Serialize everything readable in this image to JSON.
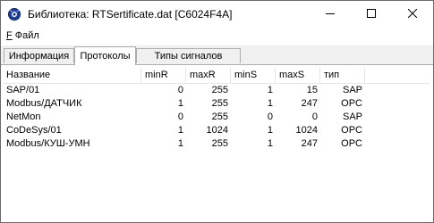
{
  "window": {
    "title": "Библиотека: RTSertificate.dat [C6024F4A]",
    "icon": "gear-sphere-icon"
  },
  "menu": {
    "items": [
      {
        "label": "Файл",
        "accelerator": "F"
      }
    ]
  },
  "tabs": [
    {
      "label": "Информация",
      "active": false
    },
    {
      "label": "Протоколы",
      "active": true
    },
    {
      "label": "Типы сигналов",
      "active": false
    }
  ],
  "table": {
    "columns": [
      "Название",
      "minR",
      "maxR",
      "minS",
      "maxS",
      "тип"
    ],
    "rows": [
      {
        "name": "SAP/01",
        "minR": "0",
        "maxR": "255",
        "minS": "1",
        "maxS": "15",
        "type": "SAP"
      },
      {
        "name": "Modbus/ДАТЧИК",
        "minR": "1",
        "maxR": "255",
        "minS": "1",
        "maxS": "247",
        "type": "OPC"
      },
      {
        "name": "NetMon",
        "minR": "0",
        "maxR": "255",
        "minS": "0",
        "maxS": "0",
        "type": "SAP"
      },
      {
        "name": "CoDeSys/01",
        "minR": "1",
        "maxR": "1024",
        "minS": "1",
        "maxS": "1024",
        "type": "OPC"
      },
      {
        "name": "Modbus/КУШ-УМН",
        "minR": "1",
        "maxR": "255",
        "minS": "1",
        "maxS": "247",
        "type": "OPC"
      }
    ]
  },
  "colors": {
    "border": "#adadad",
    "window_bg": "#f0f0f0",
    "panel_bg": "#ffffff"
  }
}
